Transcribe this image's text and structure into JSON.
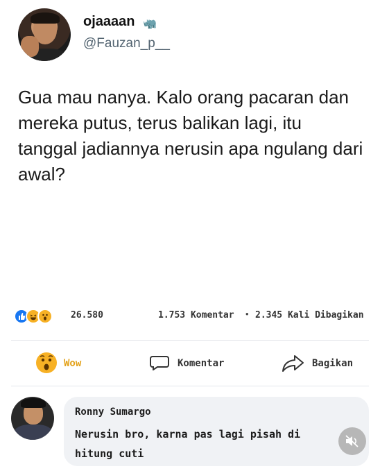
{
  "post": {
    "display_name": "ojaaaan",
    "name_emoji": "🦏",
    "handle": "@Fauzan_p__",
    "text": "Gua mau nanya. Kalo orang pacaran dan mereka putus, terus balikan lagi, itu tanggal jadiannya nerusin apa ngulang dari awal?"
  },
  "stats": {
    "reaction_icons": [
      "like-icon",
      "haha-icon",
      "wow-icon"
    ],
    "reaction_count": "26.580",
    "comment_count": "1.753 Komentar",
    "separator": "•",
    "share_count": "2.345 Kali Dibagikan"
  },
  "actions": {
    "wow_label": "Wow",
    "comment_label": "Komentar",
    "share_label": "Bagikan",
    "wow_color": "#e3a21a"
  },
  "comment": {
    "author": "Ronny Sumargo",
    "text": "Nerusin bro, karna pas lagi pisah di hitung cuti"
  },
  "colors": {
    "like_blue": "#1877f2",
    "reaction_yellow": "#f7b125",
    "bubble_bg": "#f0f2f5",
    "handle_gray": "#536471"
  }
}
